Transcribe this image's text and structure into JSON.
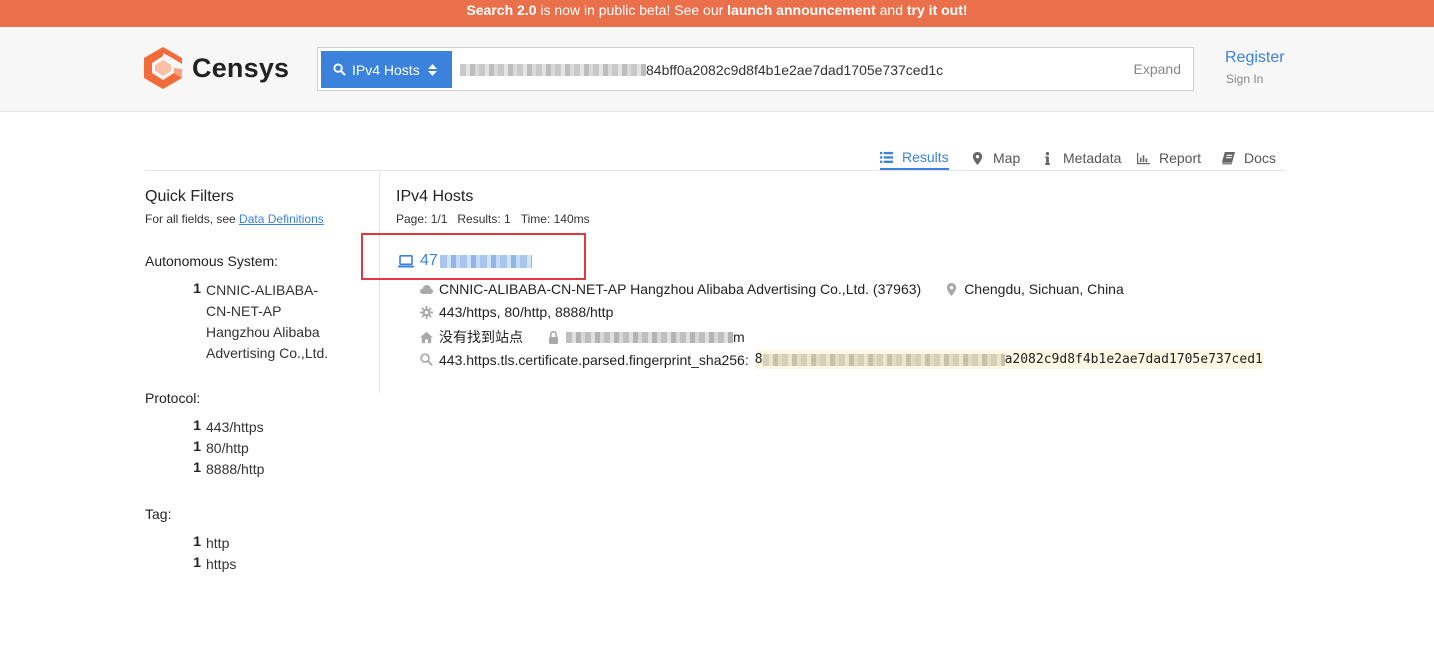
{
  "banner": {
    "part1": "Search 2.0",
    "part2": " is now in public beta! See our ",
    "part3": "launch announcement",
    "part4": " and ",
    "part5": "try it out!"
  },
  "header": {
    "logo_text": "Censys",
    "search_type": "IPv4 Hosts",
    "search_value_visible": "84bff0a2082c9d8f4b1e2ae7dad1705e737ced1c",
    "expand_label": "Expand",
    "register_label": "Register",
    "signin_label": "Sign In"
  },
  "tabs": [
    {
      "label": "Results",
      "icon": "list-icon",
      "active": true
    },
    {
      "label": "Map",
      "icon": "map-marker-icon",
      "active": false
    },
    {
      "label": "Metadata",
      "icon": "info-icon",
      "active": false
    },
    {
      "label": "Report",
      "icon": "bar-chart-icon",
      "active": false
    },
    {
      "label": "Docs",
      "icon": "book-icon",
      "active": false
    }
  ],
  "sidebar": {
    "title": "Quick Filters",
    "subtitle_prefix": "For all fields, see ",
    "subtitle_link": "Data Definitions",
    "facets": [
      {
        "title": "Autonomous System:",
        "items": [
          {
            "count": "1",
            "label": "CNNIC-ALIBABA-CN-NET-AP Hangzhou Alibaba Advertising Co.,Ltd."
          }
        ]
      },
      {
        "title": "Protocol:",
        "items": [
          {
            "count": "1",
            "label": "443/https"
          },
          {
            "count": "1",
            "label": "80/http"
          },
          {
            "count": "1",
            "label": "8888/http"
          }
        ]
      },
      {
        "title": "Tag:",
        "items": [
          {
            "count": "1",
            "label": "http"
          },
          {
            "count": "1",
            "label": "https"
          }
        ]
      }
    ]
  },
  "results": {
    "title": "IPv4 Hosts",
    "page": "Page: 1/1",
    "count": "Results: 1",
    "time": "Time: 140ms",
    "host_prefix": "47",
    "as_line": "CNNIC-ALIBABA-CN-NET-AP Hangzhou Alibaba Advertising Co.,Ltd. (37963)",
    "location": "Chengdu, Sichuan, China",
    "protocols": "443/https, 80/http, 8888/http",
    "page_title": "没有找到站点",
    "cert_name_suffix": "m",
    "fingerprint_label": "443.https.tls.certificate.parsed.fingerprint_sha256:",
    "fingerprint_prefix": "8",
    "fingerprint_suffix": "a2082c9d8f4b1e2ae7dad1705e737ced1"
  },
  "colors": {
    "banner": "#e9704a",
    "accent": "#3b82dc",
    "highlight_box": "#e0383e",
    "fingerprint_bg": "#fdf8e4"
  }
}
